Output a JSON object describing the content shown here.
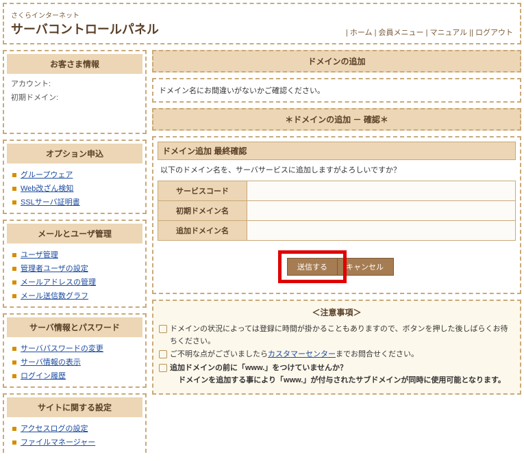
{
  "header": {
    "sub": "さくらインターネット",
    "title": "サーバコントロールパネル",
    "nav": {
      "home": "ホーム",
      "member": "会員メニュー",
      "manual": "マニュアル",
      "logout": "ログアウト",
      "sep": " | ",
      "sep2": " || "
    }
  },
  "sidebar": {
    "customer": {
      "title": "お客さま情報",
      "account_label": "アカウント:",
      "domain_label": "初期ドメイン:"
    },
    "option": {
      "title": "オプション申込",
      "items": [
        {
          "label": "グループウェア"
        },
        {
          "label": "Web改ざん検知"
        },
        {
          "label": "SSLサーバ証明書"
        }
      ]
    },
    "mailuser": {
      "title": "メールとユーザ管理",
      "items": [
        {
          "label": "ユーザ管理"
        },
        {
          "label": "管理者ユーザの設定"
        },
        {
          "label": "メールアドレスの管理"
        },
        {
          "label": "メール送信数グラフ"
        }
      ]
    },
    "server": {
      "title": "サーバ情報とパスワード",
      "items": [
        {
          "label": "サーバパスワードの変更"
        },
        {
          "label": "サーバ情報の表示"
        },
        {
          "label": "ログイン履歴"
        }
      ]
    },
    "site": {
      "title": "サイトに関する設定",
      "items": [
        {
          "label": "アクセスログの設定"
        },
        {
          "label": "ファイルマネージャー"
        }
      ]
    }
  },
  "main": {
    "page_title": "ドメインの追加",
    "message": "ドメイン名にお間違いがないかご確認ください。",
    "section_title": "＊ドメインの追加 － 確認＊",
    "form": {
      "head": "ドメイン追加 最終確認",
      "prompt": "以下のドメイン名を、サーバサービスに追加しますがよろしいですか？",
      "rows": [
        {
          "label": "サービスコード"
        },
        {
          "label": "初期ドメイン名"
        },
        {
          "label": "追加ドメイン名"
        }
      ],
      "submit": "送信する",
      "cancel": "キャンセル"
    },
    "notice": {
      "title": "＜注意事項＞",
      "p1": "ドメインの状況によっては登録に時間が掛かることもありますので、ボタンを押した後しばらくお待ちください。",
      "p2a": "ご不明な点がございましたら",
      "p2link": "カスタマーセンター",
      "p2b": "までお問合せください。",
      "p3": "追加ドメインの前に「www.」をつけていませんか？",
      "p3b": "ドメインを追加する事により「www.」が付与されたサブドメインが同時に使用可能となります。"
    }
  }
}
